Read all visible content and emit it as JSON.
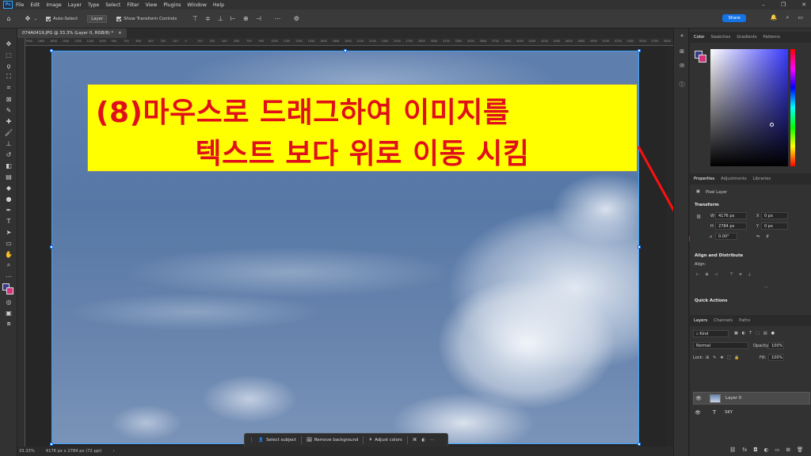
{
  "menubar": {
    "logo": "Ps",
    "items": [
      "File",
      "Edit",
      "Image",
      "Layer",
      "Type",
      "Select",
      "Filter",
      "View",
      "Plugins",
      "Window",
      "Help"
    ]
  },
  "options": {
    "auto_select_label": "Auto-Select",
    "auto_select_target": "Layer",
    "show_transform_label": "Show Transform Controls",
    "share_label": "Share"
  },
  "document": {
    "tab_title": "074A0419.JPG @ 33.3% (Layer 0, RGB/8) *",
    "tab_close": "×",
    "ruler_numbers": [
      "1950",
      "1800",
      "1650",
      "1500",
      "1350",
      "1200",
      "1050",
      "900",
      "750",
      "600",
      "450",
      "300",
      "150",
      "0",
      "150",
      "300",
      "450",
      "600",
      "750",
      "900",
      "1050",
      "1200",
      "1350",
      "1500",
      "1650",
      "1800",
      "1950",
      "2100",
      "2250",
      "2400",
      "2550",
      "2700",
      "2850",
      "3000",
      "3150",
      "3300",
      "3450",
      "3600",
      "3750",
      "3900",
      "4050",
      "4200",
      "4350",
      "4500",
      "4650",
      "4800",
      "4950",
      "5100",
      "5250",
      "5400",
      "5550",
      "5700",
      "5850",
      "6000"
    ]
  },
  "annotation": {
    "line1": "(8)마우스로 드래그하여 이미지를",
    "line2": "텍스트 보다 위로 이동 시킴",
    "bg_color": "#ffff00",
    "text_color": "#e0101a"
  },
  "taskbar": {
    "select_subject": "Select subject",
    "remove_background": "Remove background",
    "adjust_colors": "Adjust colors"
  },
  "status": {
    "zoom": "33.33%",
    "doc_size": "4176 px x 2784 px (72 ppi)"
  },
  "color_panel": {
    "tabs": [
      "Color",
      "Swatches",
      "Gradients",
      "Patterns"
    ]
  },
  "properties_panel": {
    "tabs": [
      "Properties",
      "Adjustments",
      "Libraries"
    ],
    "layer_kind": "Pixel Layer",
    "transform_title": "Transform",
    "w_label": "W",
    "w_value": "4176 px",
    "h_label": "H",
    "h_value": "2784 px",
    "x_label": "X",
    "x_value": "0 px",
    "y_label": "Y",
    "y_value": "0 px",
    "angle_value": "0.00°",
    "align_title": "Align and Distribute",
    "align_label": "Align:",
    "quick_actions_title": "Quick Actions"
  },
  "layers_panel": {
    "tabs": [
      "Layers",
      "Channels",
      "Paths"
    ],
    "kind_label": "Kind",
    "blend_mode": "Normal",
    "opacity_label": "Opacity:",
    "opacity_value": "100%",
    "lock_label": "Lock:",
    "fill_label": "Fill:",
    "fill_value": "100%",
    "layers": [
      {
        "name": "Layer 0",
        "type": "pixel",
        "selected": true
      },
      {
        "name": "SKY",
        "type": "text",
        "selected": false
      }
    ]
  }
}
